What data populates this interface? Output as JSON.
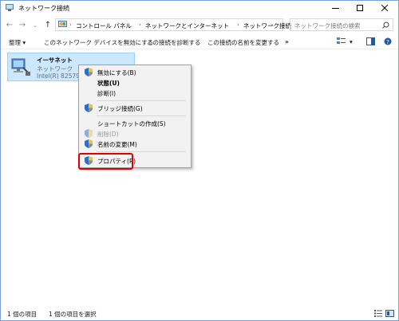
{
  "window": {
    "title": "ネットワーク接続"
  },
  "address": {
    "crumbs": [
      "コントロール パネル",
      "ネットワークとインターネット",
      "ネットワーク接続"
    ],
    "search_placeholder": "ネットワーク接続の検索"
  },
  "toolbar": {
    "organize": "整理",
    "disable": "このネットワーク デバイスを無効にする",
    "diagnose": "この接続を診断する",
    "rename": "この接続の名前を変更する",
    "more": "»"
  },
  "adapter": {
    "name": "イーサネット",
    "network": "ネットワーク",
    "device": "Intel(R) 82579LM"
  },
  "context_menu": {
    "items": [
      {
        "label": "無効にする(B)",
        "shield": true,
        "style": "normal"
      },
      {
        "label": "状態(U)",
        "shield": false,
        "style": "bold"
      },
      {
        "label": "診断(I)",
        "shield": false,
        "style": "normal"
      },
      {
        "label": "ブリッジ接続(G)",
        "shield": true,
        "style": "normal"
      },
      {
        "label": "ショートカットの作成(S)",
        "shield": false,
        "style": "normal"
      },
      {
        "label": "削除(D)",
        "shield": true,
        "style": "disabled"
      },
      {
        "label": "名前の変更(M)",
        "shield": true,
        "style": "normal"
      },
      {
        "label": "プロパティ(R)",
        "shield": true,
        "style": "normal"
      }
    ]
  },
  "status": {
    "count": "1 個の項目",
    "selected": "1 個の項目を選択"
  },
  "colors": {
    "highlight": "#e00000",
    "selection": "#cce8ff",
    "menu_bg": "#f2f2f2"
  }
}
